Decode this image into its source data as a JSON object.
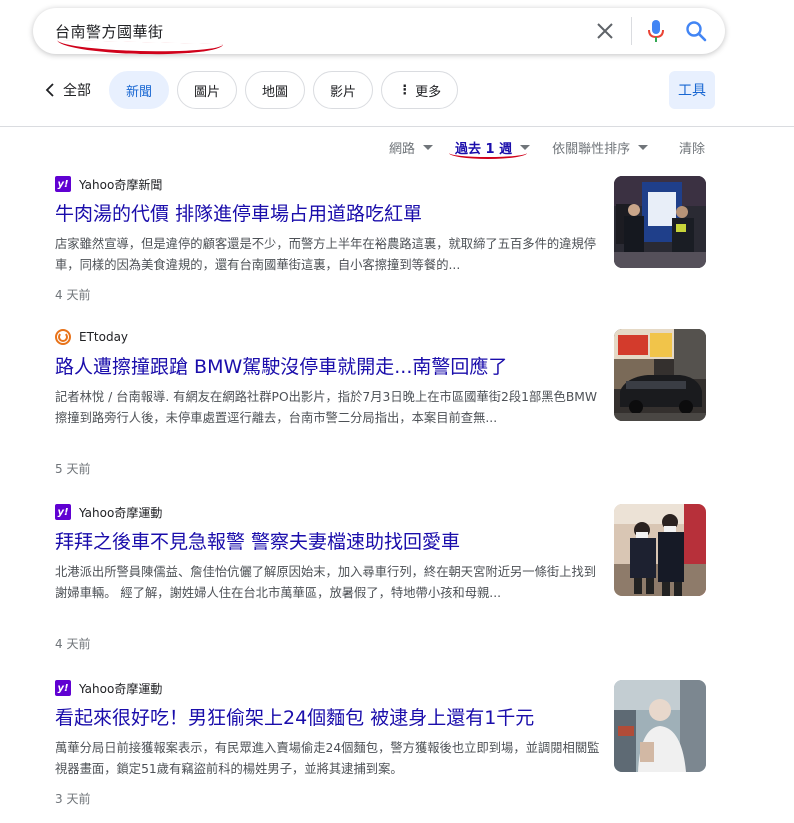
{
  "search": {
    "query": "台南警方國華街"
  },
  "tabs": {
    "back_label": "全部",
    "items": [
      {
        "label": "新聞",
        "active": true
      },
      {
        "label": "圖片",
        "active": false
      },
      {
        "label": "地圖",
        "active": false
      },
      {
        "label": "影片",
        "active": false
      },
      {
        "label": "更多",
        "active": false
      }
    ],
    "tools_label": "工具"
  },
  "filters": {
    "web": "網路",
    "time": "過去 1 週",
    "sort": "依關聯性排序",
    "clear": "清除"
  },
  "results": [
    {
      "source": "Yahoo奇摩新聞",
      "source_icon": "yahoo-icon",
      "title": "牛肉湯的代價 排隊進停車場占用道路吃紅單",
      "snippet": "店家雖然宣導，但是違停的顧客還是不少，而警方上半年在裕農路這裏，就取締了五百多件的違規停車，同樣的因為美食違規的，還有台南國華街這裏，自小客擦撞到等餐的...",
      "time": "4 天前"
    },
    {
      "source": "ETtoday",
      "source_icon": "ettoday-icon",
      "title": "路人遭擦撞跟蹌 BMW駕駛沒停車就開走...南警回應了",
      "snippet": "記者林悅 / 台南報導. 有網友在網路社群PO出影片，指於7月3日晚上在市區國華街2段1部黑色BMW擦撞到路旁行人後，未停車處置逕行離去，台南市警二分局指出，本案目前查無...",
      "time": "5 天前"
    },
    {
      "source": "Yahoo奇摩運動",
      "source_icon": "yahoo-icon",
      "title": "拜拜之後車不見急報警 警察夫妻檔速助找回愛車",
      "snippet": "北港派出所警員陳儒益、詹佳怡伉儷了解原因始末，加入尋車行列，終在朝天宮附近另一條街上找到謝婦車輛。 經了解，謝姓婦人住在台北市萬華區，放暑假了，特地帶小孩和母親...",
      "time": "4 天前"
    },
    {
      "source": "Yahoo奇摩運動",
      "source_icon": "yahoo-icon",
      "title": "看起來很好吃！男狂偷架上24個麵包 被逮身上還有1千元",
      "snippet": "萬華分局日前接獲報案表示，有民眾進入賣場偷走24個麵包，警方獲報後也立即到場，並調閱相關監視器畫面，鎖定51歲有竊盜前科的楊姓男子，並將其逮捕到案。",
      "time": "3 天前"
    }
  ]
}
